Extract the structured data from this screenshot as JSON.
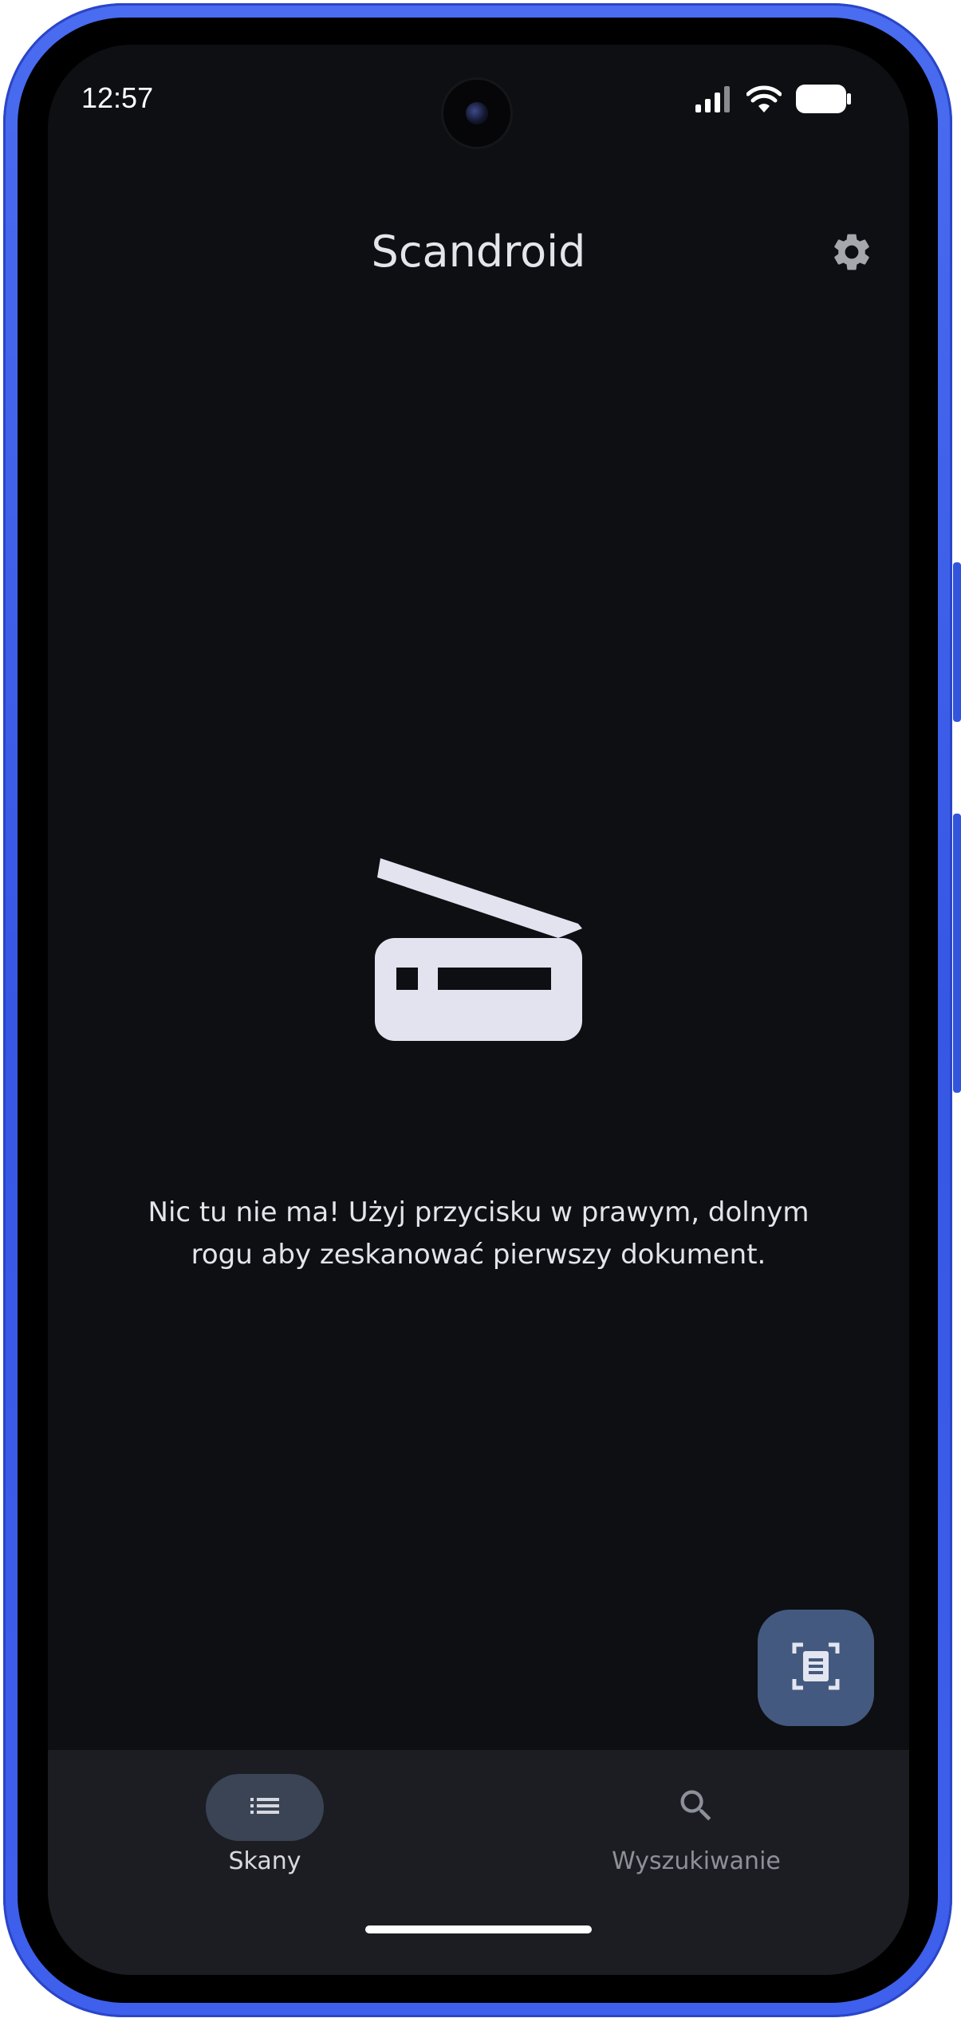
{
  "status_bar": {
    "time": "12:57",
    "icons": [
      "signal-icon",
      "wifi-icon",
      "battery-icon"
    ]
  },
  "app_bar": {
    "title": "Scandroid",
    "settings_icon": "gear-icon"
  },
  "empty_state": {
    "icon": "scanner-icon",
    "message": "Nic tu nie ma! Użyj przycisku w prawym, dolnym rogu aby zeskanować pierwszy dokument."
  },
  "fab": {
    "icon": "document-scanner-icon"
  },
  "bottom_nav": {
    "items": [
      {
        "label": "Skany",
        "icon": "list-icon",
        "active": true
      },
      {
        "label": "Wyszukiwanie",
        "icon": "search-icon",
        "active": false
      }
    ]
  },
  "colors": {
    "background": "#0e0f13",
    "nav_background": "#1b1d22",
    "fab": "#44597f",
    "active_pill": "#3b4455",
    "device_frame": "#3557e4"
  }
}
